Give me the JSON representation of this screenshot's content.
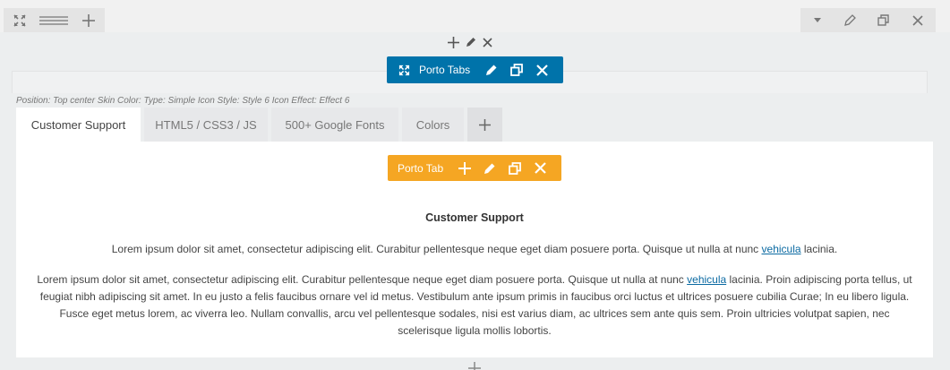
{
  "row_toolbar": {
    "left_icons": [
      "move-icon",
      "column-layout-icon",
      "plus-icon"
    ],
    "right_icons": [
      "caret-down-icon",
      "pencil-icon",
      "clone-icon",
      "close-icon"
    ]
  },
  "column_controls": [
    "plus-icon",
    "pencil-icon",
    "close-icon"
  ],
  "porto_tabs": {
    "label": "Porto Tabs",
    "params": "Position: Top center  Skin Color:   Type: Simple  Icon Style: Style 6  Icon Effect: Effect 6"
  },
  "tabs": [
    {
      "label": "Customer Support",
      "active": true
    },
    {
      "label": "HTML5 / CSS3 / JS",
      "active": false
    },
    {
      "label": "500+ Google Fonts",
      "active": false
    },
    {
      "label": "Colors",
      "active": false
    }
  ],
  "porto_tab": {
    "label": "Porto Tab"
  },
  "content": {
    "heading": "Customer Support",
    "p1_before": "Lorem ipsum dolor sit amet, consectetur adipiscing elit. Curabitur pellentesque neque eget diam posuere porta. Quisque ut nulla at nunc ",
    "p1_link": "vehicula",
    "p1_after": " lacinia.",
    "p2_before": "Lorem ipsum dolor sit amet, consectetur adipiscing elit. Curabitur pellentesque neque eget diam posuere porta. Quisque ut nulla at nunc ",
    "p2_link": "vehicula",
    "p2_after": " lacinia. Proin adipiscing porta tellus, ut feugiat nibh adipiscing sit amet. In eu justo a felis faucibus ornare vel id metus. Vestibulum ante ipsum primis in faucibus orci luctus et ultrices posuere cubilia Curae; In eu libero ligula. Fusce eget metus lorem, ac viverra leo. Nullam convallis, arcu vel pellentesque sodales, nisi est varius diam, ac ultrices sem ante quis sem. Proin ultricies volutpat sapien, nec scelerisque ligula mollis lobortis."
  },
  "colors": {
    "blue_bar": "#0073aa",
    "orange_bar": "#f5a623",
    "link": "#0b6aa2"
  }
}
